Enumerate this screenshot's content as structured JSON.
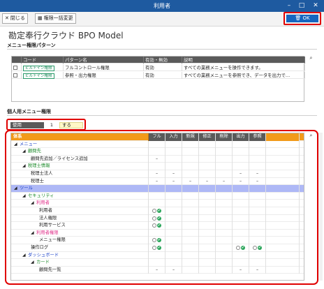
{
  "window": {
    "title": "利用者",
    "minimize": "–",
    "maximize": "□",
    "close": "✕"
  },
  "toolbar": {
    "close_label": "閉じる",
    "close_icon": "✕",
    "bulk_label": "権限一括変更",
    "ok_label": "OK",
    "ok_icon": "🗑"
  },
  "app_title": "勘定奉行クラウド BPO Model",
  "menu_section": {
    "title": "メニュー権限パターン",
    "columns": [
      "コード",
      "パターン名",
      "有効・無効",
      "説明"
    ],
    "rows": [
      {
        "code": "ビルトイン権限",
        "name": "フルコントロール権限",
        "status": "有効",
        "description": "すべての業務メニューを操作できます。"
      },
      {
        "code": "ビルトイン権限",
        "name": "参照・出力権限",
        "status": "有効",
        "description": "すべての業務メニューを参照でき、データを出力で…"
      }
    ]
  },
  "personal_section": {
    "title": "個人用メニュー権限",
    "use_label": "使用",
    "use_number": "1",
    "use_value": "する"
  },
  "tree": {
    "header": "体系",
    "perm_columns": [
      "フル",
      "入力",
      "新規",
      "修正",
      "削除",
      "出力",
      "参照"
    ],
    "rows": [
      {
        "label": "メニュー",
        "level": 0,
        "color": "blue",
        "arrow": "◢",
        "cells": [
          "",
          "",
          "",
          "",
          "",
          "",
          ""
        ]
      },
      {
        "label": "顧問先",
        "level": 1,
        "color": "green",
        "arrow": "◢",
        "cells": [
          "",
          "",
          "",
          "",
          "",
          "",
          ""
        ]
      },
      {
        "label": "顧問先追加／ライセンス追加",
        "level": 2,
        "color": "",
        "arrow": "",
        "cells": [
          "–",
          "",
          "",
          "",
          "",
          "",
          ""
        ]
      },
      {
        "label": "税理士情報",
        "level": 1,
        "color": "green",
        "arrow": "◢",
        "cells": [
          "",
          "",
          "",
          "",
          "",
          "",
          ""
        ]
      },
      {
        "label": "税理士法人",
        "level": 2,
        "color": "",
        "arrow": "",
        "cells": [
          "–",
          "–",
          "",
          "",
          "",
          "–",
          "–"
        ]
      },
      {
        "label": "税理士",
        "level": 2,
        "color": "",
        "arrow": "",
        "cells": [
          "–",
          "–",
          "–",
          "–",
          "–",
          "–",
          "–"
        ]
      },
      {
        "label": "ツール",
        "level": 0,
        "color": "blue",
        "arrow": "◢",
        "selected": true,
        "cells": [
          "",
          "",
          "",
          "",
          "",
          "",
          ""
        ]
      },
      {
        "label": "セキュリティ",
        "level": 1,
        "color": "green",
        "arrow": "◢",
        "cells": [
          "",
          "",
          "",
          "",
          "",
          "",
          ""
        ]
      },
      {
        "label": "利用者",
        "level": 2,
        "color": "pink",
        "arrow": "◢",
        "cells": [
          "",
          "",
          "",
          "",
          "",
          "",
          ""
        ]
      },
      {
        "label": "利用者",
        "level": 3,
        "color": "",
        "arrow": "",
        "cells": [
          "ok",
          "",
          "",
          "",
          "",
          "",
          ""
        ]
      },
      {
        "label": "法人権限",
        "level": 3,
        "color": "",
        "arrow": "",
        "cells": [
          "ok",
          "",
          "",
          "",
          "",
          "",
          ""
        ]
      },
      {
        "label": "利用サービス",
        "level": 3,
        "color": "",
        "arrow": "",
        "cells": [
          "ok",
          "",
          "",
          "",
          "",
          "",
          ""
        ]
      },
      {
        "label": "利用者権限",
        "level": 2,
        "color": "pink",
        "arrow": "◢",
        "cells": [
          "",
          "",
          "",
          "",
          "",
          "",
          ""
        ]
      },
      {
        "label": "メニュー権限",
        "level": 3,
        "color": "",
        "arrow": "",
        "cells": [
          "ok",
          "",
          "",
          "",
          "",
          "",
          ""
        ]
      },
      {
        "label": "操作ログ",
        "level": 2,
        "color": "",
        "arrow": "",
        "cells": [
          "ok",
          "",
          "",
          "",
          "",
          "ok",
          "ok"
        ]
      },
      {
        "label": "ダッシュボード",
        "level": 1,
        "color": "blue",
        "arrow": "◢",
        "cells": [
          "",
          "",
          "",
          "",
          "",
          "",
          ""
        ]
      },
      {
        "label": "カード",
        "level": 2,
        "color": "green",
        "arrow": "◢",
        "cells": [
          "",
          "",
          "",
          "",
          "",
          "",
          ""
        ]
      },
      {
        "label": "顧問先一覧",
        "level": 3,
        "color": "",
        "arrow": "",
        "cells": [
          "–",
          "–",
          "",
          "",
          "",
          "–",
          "–"
        ]
      }
    ]
  },
  "icons": {
    "search": "search-icon",
    "check": "✔"
  },
  "colors": {
    "titlebar": "#1e5aa0",
    "ok": "#1565c0",
    "highlight": "#e00000",
    "tree_header": "#f29a1a",
    "selected_row": "#aeb8f6"
  }
}
